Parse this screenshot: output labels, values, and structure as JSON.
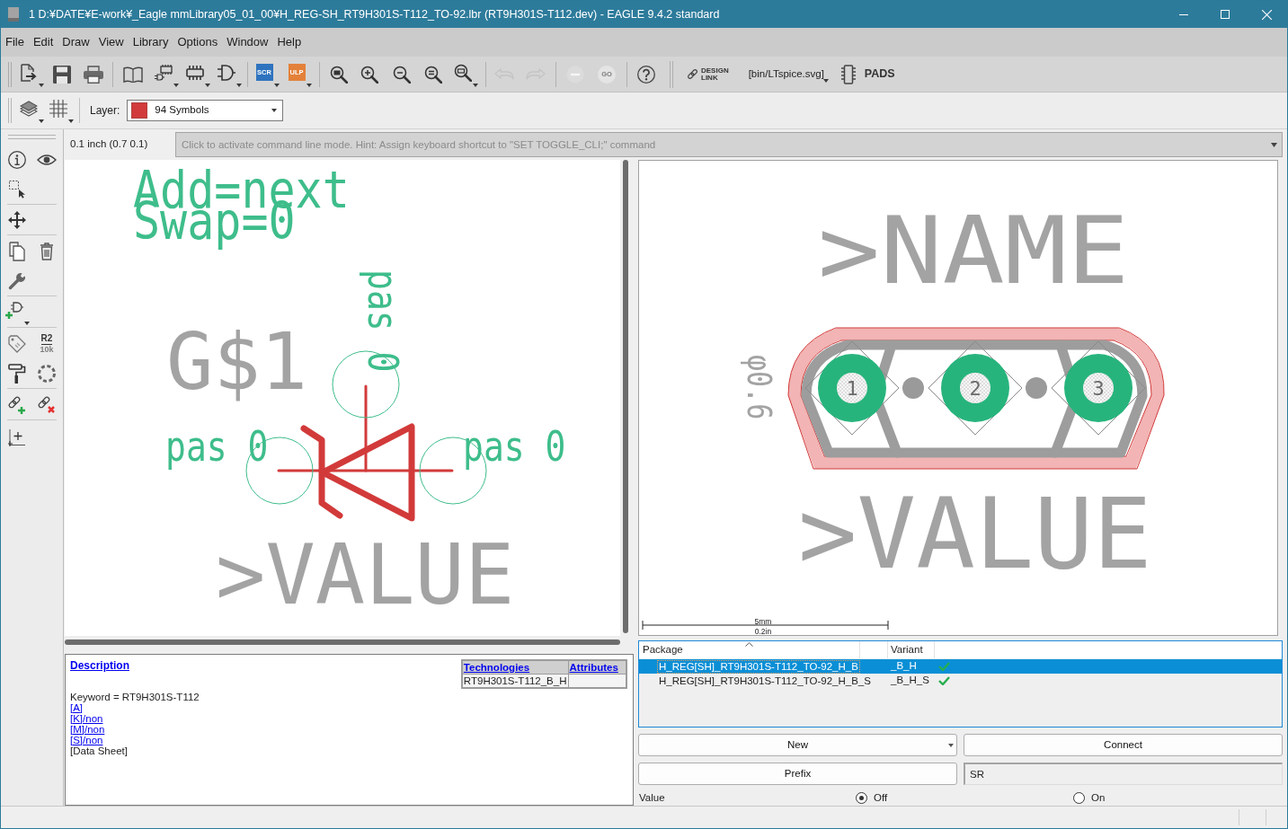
{
  "window": {
    "title": "1 D:¥DATE¥E-work¥_Eagle mmLibrary05_01_00¥H_REG-SH_RT9H301S-T112_TO-92.lbr (RT9H301S-T112.dev) - EAGLE 9.4.2 standard"
  },
  "menu": [
    "File",
    "Edit",
    "Draw",
    "View",
    "Library",
    "Options",
    "Window",
    "Help"
  ],
  "toolbar": {
    "script_buttons": [
      {
        "label": "SCR",
        "color": "#2f73bf"
      },
      {
        "label": "ULP",
        "color": "#e3813a"
      }
    ],
    "undo": {
      "disabled": true
    },
    "redo": {
      "disabled": true
    },
    "stop": {
      "disabled": true
    },
    "go": {
      "label": "GO",
      "disabled": true
    },
    "design_link": {
      "label": "DESIGN LINK"
    },
    "script_menu": {
      "label": "[bin/LTspice.svg]"
    },
    "pads": {
      "label": "PADS"
    }
  },
  "layer_bar": {
    "label": "Layer:",
    "layer": {
      "name": "94 Symbols",
      "color": "#d23b3b"
    }
  },
  "left_toolbar": {
    "value_tool": {
      "name": "R2",
      "value": "10k"
    }
  },
  "command_line": {
    "coordinates": "0.1 inch (0.7 0.1)",
    "placeholder": "Click to activate command line mode. Hint: Assign keyboard shortcut to \"SET TOGGLE_CLI;\" command"
  },
  "symbol_view": {
    "add_label": "Add=next",
    "swap_label": "Swap=0",
    "gate_name": "G$1",
    "pins": [
      {
        "label": "pas 0"
      },
      {
        "label": "pas 0"
      },
      {
        "label": "pas 0"
      }
    ],
    "value_label": ">VALUE"
  },
  "package_view": {
    "name_label": ">NAME",
    "drill_label": "φ0.6",
    "pads": [
      {
        "label": "1"
      },
      {
        "label": "2"
      },
      {
        "label": "3"
      }
    ],
    "value_label": ">VALUE",
    "scale": {
      "metric": "5mm",
      "imperial": "0.2in"
    }
  },
  "description": {
    "heading": "Description",
    "table": {
      "columns": [
        "Technologies",
        "Attributes"
      ],
      "rows": [
        {
          "technology": "RT9H301S-T112_B_H"
        }
      ]
    },
    "lines": [
      {
        "kind": "text",
        "text": "Keyword = RT9H301S-T112"
      },
      {
        "kind": "link",
        "text": "[A]"
      },
      {
        "kind": "link",
        "text": "[K]/non"
      },
      {
        "kind": "link",
        "text": "[M]/non"
      },
      {
        "kind": "link",
        "text": "[S]/non"
      },
      {
        "kind": "text",
        "text": "[Data Sheet]"
      }
    ]
  },
  "package_list": {
    "columns": [
      "Package",
      "Variant"
    ],
    "rows": [
      {
        "package": "H_REG[SH]_RT9H301S-T112_TO-92_H_B",
        "variant": "_B_H",
        "connected": true,
        "selected": true
      },
      {
        "package": "H_REG[SH]_RT9H301S-T112_TO-92_H_B_S",
        "variant": "_B_H_S",
        "connected": true,
        "selected": false
      }
    ]
  },
  "device_controls": {
    "new_button": {
      "label": "New"
    },
    "connect_button": {
      "label": "Connect"
    },
    "prefix_button": {
      "label": "Prefix"
    },
    "prefix_field": {
      "value": "SR"
    },
    "value_option": {
      "label": "Value",
      "options": [
        {
          "label": "Off",
          "selected": true
        },
        {
          "label": "On",
          "selected": false
        }
      ]
    }
  }
}
